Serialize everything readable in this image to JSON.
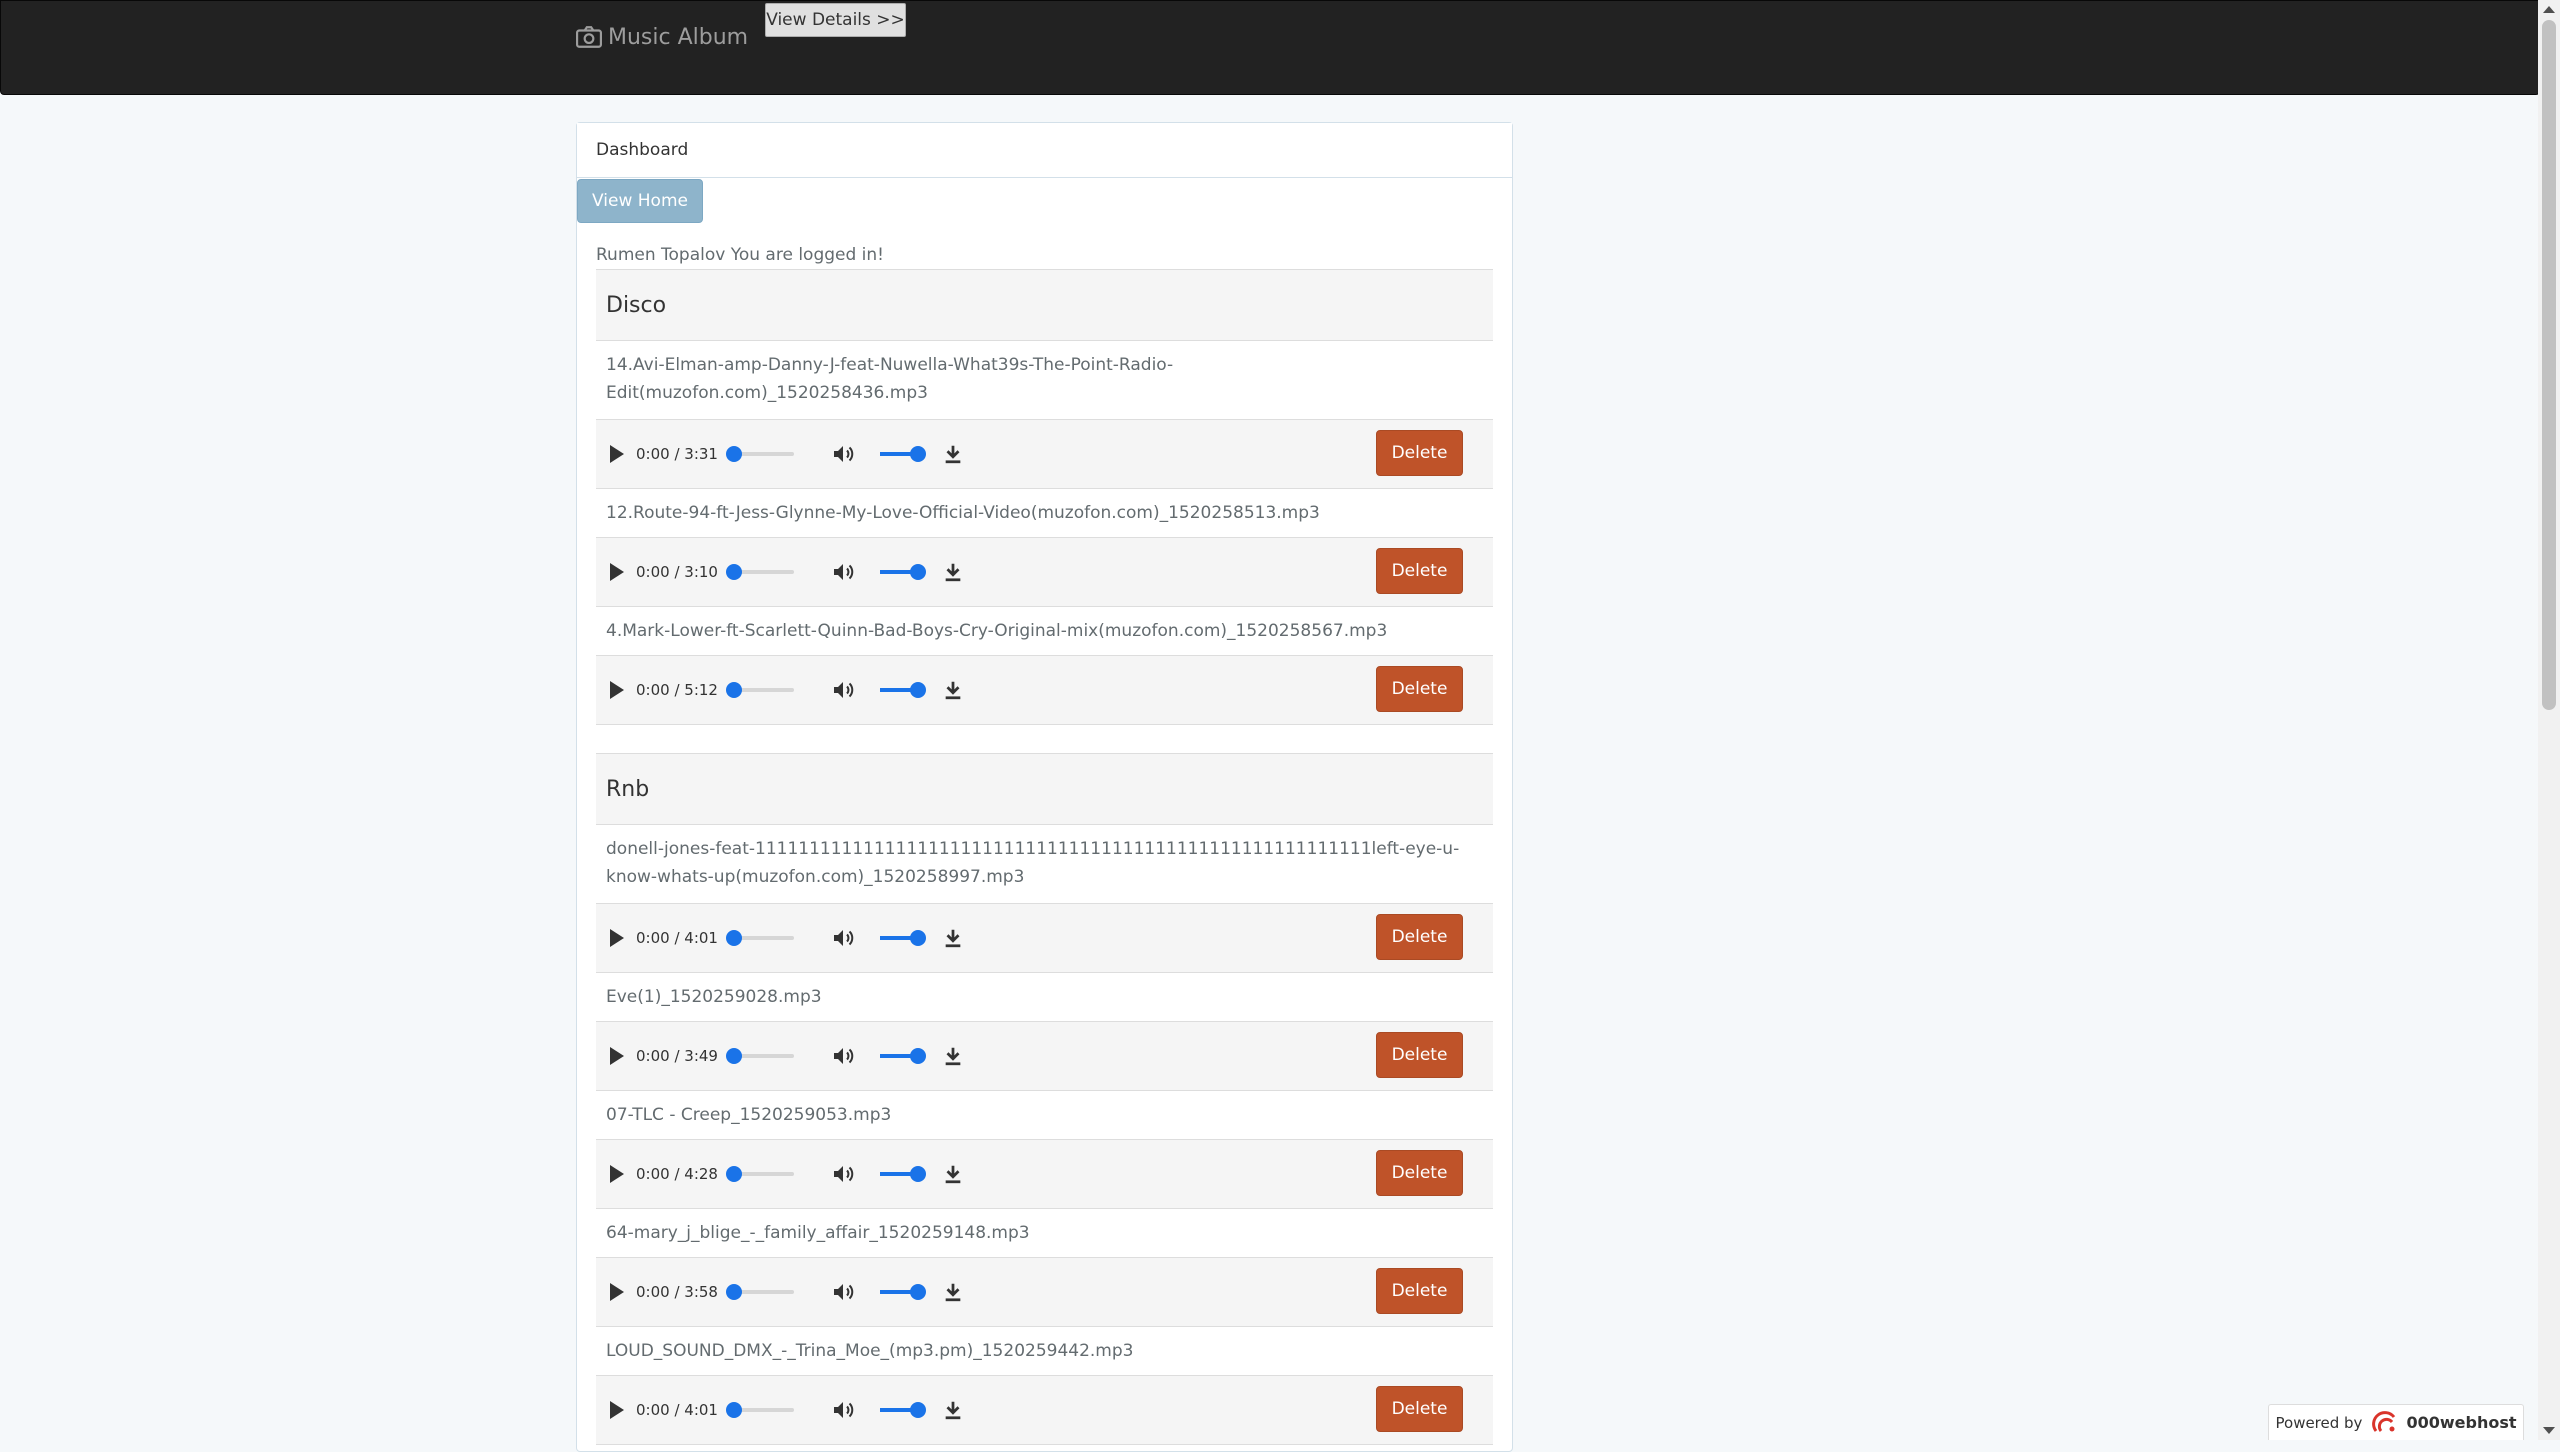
{
  "navbar": {
    "brand": "Music Album",
    "details_button": "View Details >>"
  },
  "panel": {
    "heading": "Dashboard",
    "home_button": "View Home",
    "logged_in_text": "Rumen Topalov You are logged in!"
  },
  "categories": [
    {
      "name": "Disco",
      "songs": [
        {
          "file": "14.Avi-Elman-amp-Danny-J-feat-Nuwella-What39s-The-Point-Radio-Edit(muzofon.com)_1520258436.mp3",
          "time": "0:00 / 3:31"
        },
        {
          "file": "12.Route-94-ft-Jess-Glynne-My-Love-Official-Video(muzofon.com)_1520258513.mp3",
          "time": "0:00 / 3:10"
        },
        {
          "file": "4.Mark-Lower-ft-Scarlett-Quinn-Bad-Boys-Cry-Original-mix(muzofon.com)_1520258567.mp3",
          "time": "0:00 / 5:12"
        }
      ]
    },
    {
      "name": "Rnb",
      "songs": [
        {
          "file": "donell-jones-feat-111111111111111111111111111111111111111111111111111111111left-eye-u-know-whats-up(muzofon.com)_1520258997.mp3",
          "time": "0:00 / 4:01"
        },
        {
          "file": "Eve(1)_1520259028.mp3",
          "time": "0:00 / 3:49"
        },
        {
          "file": "07-TLC - Creep_1520259053.mp3",
          "time": "0:00 / 4:28"
        },
        {
          "file": "64-mary_j_blige_-_family_affair_1520259148.mp3",
          "time": "0:00 / 3:58"
        },
        {
          "file": "LOUD_SOUND_DMX_-_Trina_Moe_(mp3.pm)_1520259442.mp3",
          "time": "0:00 / 4:01"
        }
      ]
    }
  ],
  "delete_label": "Delete",
  "footer": {
    "powered_by": "Powered by",
    "host": "000webhost"
  },
  "colors": {
    "navbar": "#222222",
    "delete": "#bf5329",
    "home_button": "#8eb4cb",
    "player_accent": "#1a73e8"
  }
}
